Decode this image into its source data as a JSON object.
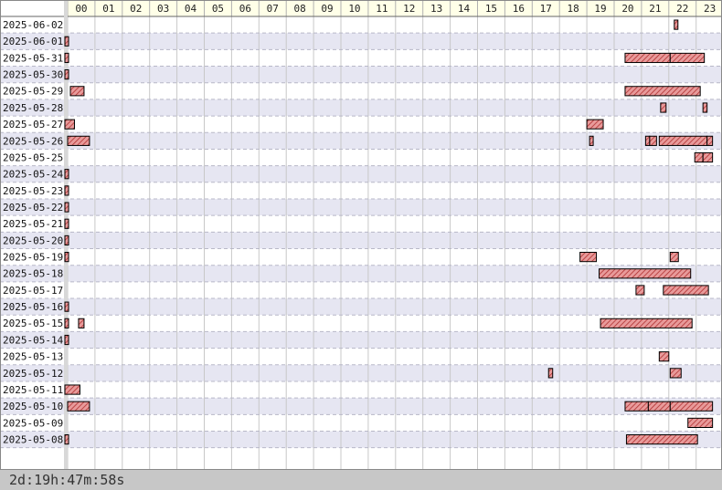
{
  "chart_data": {
    "type": "gantt",
    "x_unit": "hour of day",
    "xlim": [
      0,
      24
    ],
    "hour_labels": [
      "00",
      "01",
      "02",
      "03",
      "04",
      "05",
      "06",
      "07",
      "08",
      "09",
      "10",
      "11",
      "12",
      "13",
      "14",
      "15",
      "16",
      "17",
      "18",
      "19",
      "20",
      "21",
      "22",
      "23"
    ],
    "rows": [
      {
        "date": "2025-06-02",
        "intervals": [
          [
            22.2,
            22.28
          ]
        ]
      },
      {
        "date": "2025-06-01",
        "intervals": [
          [
            -0.1,
            0.0
          ]
        ]
      },
      {
        "date": "2025-05-31",
        "intervals": [
          [
            -0.1,
            0.0
          ],
          [
            20.4,
            22.05
          ],
          [
            22.05,
            23.3
          ]
        ]
      },
      {
        "date": "2025-05-30",
        "intervals": [
          [
            -0.1,
            0.0
          ]
        ]
      },
      {
        "date": "2025-05-29",
        "intervals": [
          [
            0.1,
            0.6
          ],
          [
            20.4,
            23.15
          ]
        ]
      },
      {
        "date": "2025-05-28",
        "intervals": [
          [
            21.7,
            21.9
          ],
          [
            23.25,
            23.4
          ]
        ]
      },
      {
        "date": "2025-05-27",
        "intervals": [
          [
            -0.1,
            0.25
          ],
          [
            19.0,
            19.6
          ]
        ]
      },
      {
        "date": "2025-05-26",
        "intervals": [
          [
            0.0,
            0.8
          ],
          [
            19.1,
            19.2
          ],
          [
            21.15,
            21.3
          ],
          [
            21.3,
            21.55
          ],
          [
            21.65,
            23.4
          ],
          [
            23.4,
            23.6
          ]
        ]
      },
      {
        "date": "2025-05-25",
        "intervals": [
          [
            22.95,
            23.25
          ],
          [
            23.25,
            23.6
          ]
        ]
      },
      {
        "date": "2025-05-24",
        "intervals": [
          [
            -0.1,
            0.0
          ]
        ]
      },
      {
        "date": "2025-05-23",
        "intervals": [
          [
            -0.1,
            0.0
          ]
        ]
      },
      {
        "date": "2025-05-22",
        "intervals": [
          [
            -0.1,
            0.0
          ]
        ]
      },
      {
        "date": "2025-05-21",
        "intervals": [
          [
            -0.1,
            0.0
          ]
        ]
      },
      {
        "date": "2025-05-20",
        "intervals": [
          [
            -0.1,
            0.0
          ]
        ]
      },
      {
        "date": "2025-05-19",
        "intervals": [
          [
            -0.1,
            0.0
          ],
          [
            18.75,
            19.35
          ],
          [
            22.05,
            22.35
          ]
        ]
      },
      {
        "date": "2025-05-18",
        "intervals": [
          [
            19.45,
            22.8
          ]
        ]
      },
      {
        "date": "2025-05-17",
        "intervals": [
          [
            20.8,
            21.1
          ],
          [
            21.8,
            23.45
          ]
        ]
      },
      {
        "date": "2025-05-16",
        "intervals": [
          [
            -0.1,
            0.0
          ]
        ]
      },
      {
        "date": "2025-05-15",
        "intervals": [
          [
            -0.1,
            0.0
          ],
          [
            0.4,
            0.6
          ],
          [
            19.5,
            22.85
          ]
        ]
      },
      {
        "date": "2025-05-14",
        "intervals": [
          [
            -0.1,
            0.0
          ]
        ]
      },
      {
        "date": "2025-05-13",
        "intervals": [
          [
            21.65,
            22.0
          ]
        ]
      },
      {
        "date": "2025-05-12",
        "intervals": [
          [
            17.6,
            17.75
          ],
          [
            22.05,
            22.45
          ]
        ]
      },
      {
        "date": "2025-05-11",
        "intervals": [
          [
            -0.1,
            0.45
          ]
        ]
      },
      {
        "date": "2025-05-10",
        "intervals": [
          [
            0.0,
            0.8
          ],
          [
            20.4,
            21.25
          ],
          [
            21.25,
            22.05
          ],
          [
            22.05,
            23.6
          ]
        ]
      },
      {
        "date": "2025-05-09",
        "intervals": [
          [
            22.7,
            23.6
          ]
        ]
      },
      {
        "date": "2025-05-08",
        "intervals": [
          [
            -0.1,
            0.0
          ],
          [
            20.45,
            23.05
          ]
        ]
      }
    ],
    "colors": {
      "bar_fill": "#e89a9a",
      "bar_hatch": "#b03030",
      "bar_border": "#000000",
      "row_alt": "#e6e6f2",
      "header_bg": "#ffffe8",
      "footer_bg": "#c7c7c7"
    }
  },
  "footer": {
    "total_time": "2d:19h:47m:58s"
  }
}
